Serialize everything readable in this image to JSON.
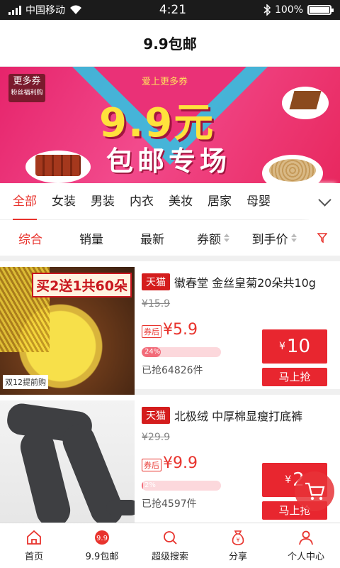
{
  "status_bar": {
    "carrier": "中国移动",
    "time": "4:21",
    "battery": "100%"
  },
  "title": "9.9包邮",
  "banner": {
    "badge_main": "更多券",
    "badge_sub": "粉丝福利购",
    "slogan": "爱上更多券",
    "headline": "9.9元",
    "subhead": "包邮专场"
  },
  "categories": [
    "全部",
    "女装",
    "男装",
    "内衣",
    "美妆",
    "居家",
    "母婴"
  ],
  "sort": {
    "items": [
      "综合",
      "销量",
      "最新",
      "券额",
      "到手价"
    ],
    "active": "综合"
  },
  "products": [
    {
      "tag": "天猫",
      "name": "徽春堂 金丝皇菊20朵共10g",
      "original_price": "¥15.9",
      "after_label": "券后",
      "price": "¥5.9",
      "progress_label": "24%",
      "progress": 0.24,
      "sold": "已抢64826件",
      "coupon_symbol": "¥",
      "coupon_value": "10",
      "button": "马上抢",
      "image_promo": "买2送1共60朵",
      "image_tag": "双12提前购"
    },
    {
      "tag": "天猫",
      "name": "北极绒 中厚棉显瘦打底裤",
      "original_price": "¥29.9",
      "after_label": "券后",
      "price": "¥9.9",
      "progress_label": "2%",
      "progress": 0.02,
      "sold": "已抢4597件",
      "coupon_symbol": "¥",
      "coupon_value": "2",
      "button": "马上抢"
    }
  ],
  "bottom_nav": [
    {
      "label": "首页",
      "icon": "home-icon"
    },
    {
      "label": "9.9包邮",
      "icon": "nine-nine-icon"
    },
    {
      "label": "超级搜索",
      "icon": "search-icon"
    },
    {
      "label": "分享",
      "icon": "money-bag-icon"
    },
    {
      "label": "个人中心",
      "icon": "person-icon"
    }
  ],
  "colors": {
    "accent": "#e8332d",
    "status_bar": "#1b1b1b",
    "banner": "#e6246b"
  }
}
